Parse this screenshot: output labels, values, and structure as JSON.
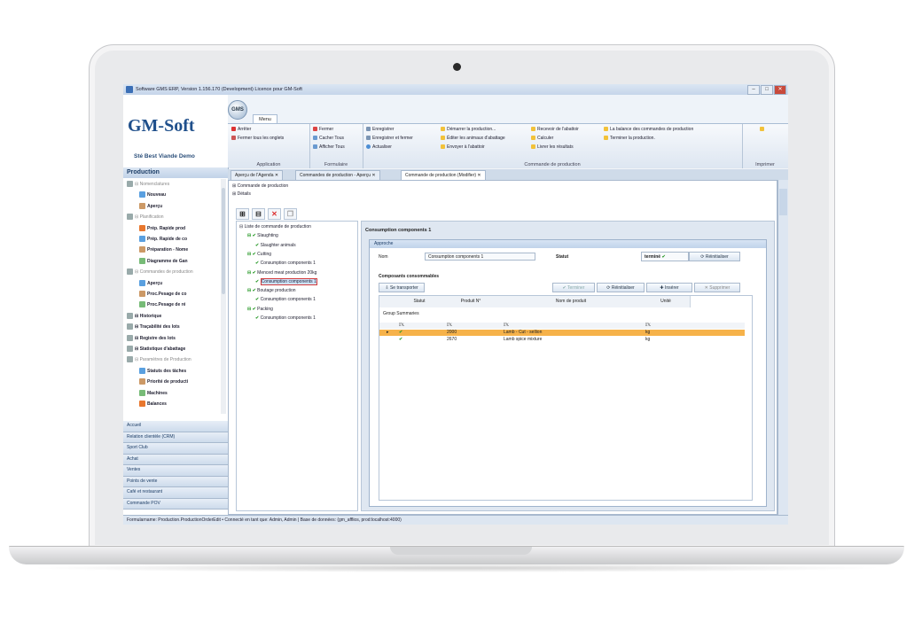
{
  "window": {
    "title": "Software GMS ERP, Version 1.156.170 (Development) Licence pour GM-Soft"
  },
  "logo": {
    "brand": "GM-Soft",
    "company": "Sté Best Viande Demo"
  },
  "ribbon": {
    "tab": "Menu",
    "groups": [
      {
        "label": "Application",
        "items": [
          "Arrêter",
          "Fermer tous les onglets"
        ]
      },
      {
        "label": "Formulaire",
        "items": [
          "Fermer",
          "Cacher Tous",
          "Afficher Tous"
        ]
      },
      {
        "label": "Commande de production",
        "items": [
          "Enregistrer",
          "Enregistrer et fermer",
          "Actualiser",
          "Démarrer la production...",
          "Éditer les animaux d'abattage",
          "Envoyer à l'abattoir",
          "Recevoir de l'abattoir",
          "Calculer",
          "Livrer les résultats",
          "La balance des commandes de production",
          "Terminer la production."
        ]
      },
      {
        "label": "Imprimer",
        "items": []
      }
    ]
  },
  "left_panel": {
    "title": "Production",
    "tree": [
      {
        "label": "Nomenclatures",
        "level": 0,
        "bold": false
      },
      {
        "label": "Nouveau",
        "level": 1,
        "bold": true
      },
      {
        "label": "Aperçu",
        "level": 1,
        "bold": true
      },
      {
        "label": "Planification",
        "level": 0,
        "bold": false
      },
      {
        "label": "Prép. Rapide prod",
        "level": 1,
        "bold": true
      },
      {
        "label": "Prép. Rapide de co",
        "level": 1,
        "bold": true
      },
      {
        "label": "Préparation - Nome",
        "level": 1,
        "bold": true
      },
      {
        "label": "Diagramme de Gan",
        "level": 1,
        "bold": true
      },
      {
        "label": "Commandes de production",
        "level": 0,
        "bold": false
      },
      {
        "label": "Aperçu",
        "level": 1,
        "bold": true
      },
      {
        "label": "Proc.Pesage de co",
        "level": 1,
        "bold": true
      },
      {
        "label": "Proc.Pesage de ré",
        "level": 1,
        "bold": true
      },
      {
        "label": "Historique",
        "level": 0,
        "bold": true
      },
      {
        "label": "Traçabilité des lots",
        "level": 0,
        "bold": true
      },
      {
        "label": "Registre des lots",
        "level": 0,
        "bold": true
      },
      {
        "label": "Statistique d'abattage",
        "level": 0,
        "bold": true
      },
      {
        "label": "Paramètres de Production",
        "level": 0,
        "bold": false
      },
      {
        "label": "Statuts des tâches",
        "level": 1,
        "bold": true
      },
      {
        "label": "Priorité de producti",
        "level": 1,
        "bold": true
      },
      {
        "label": "Machines",
        "level": 1,
        "bold": true
      },
      {
        "label": "Balances",
        "level": 1,
        "bold": true
      }
    ],
    "nav": [
      "Accueil",
      "Relation clientèle (CRM)",
      "Sport Club",
      "Achat",
      "Ventes",
      "Points de vente",
      "Café et restaurant",
      "Commande POV"
    ]
  },
  "doc_tabs": [
    "Aperçu de l'Agenda",
    "Commandes de production - Aperçu",
    "Commande de production (Modifier)"
  ],
  "content": {
    "sections": [
      "Commande de production",
      "Détails"
    ],
    "production_tree": [
      {
        "label": "Liste de commande de production",
        "level": 0,
        "check": false
      },
      {
        "label": "Slaughting",
        "level": 1,
        "check": true
      },
      {
        "label": "Slaughter animals",
        "level": 2,
        "check": true
      },
      {
        "label": "Cutting",
        "level": 1,
        "check": true
      },
      {
        "label": "Consumption components 1",
        "level": 2,
        "check": true
      },
      {
        "label": "Menced meat production 20kg",
        "level": 1,
        "check": true
      },
      {
        "label": "Consumption components 1",
        "level": 2,
        "check": true,
        "selected": true
      },
      {
        "label": "Boutage production",
        "level": 1,
        "check": true
      },
      {
        "label": "Consumption components 1",
        "level": 2,
        "check": true
      },
      {
        "label": "Packing",
        "level": 1,
        "check": true
      },
      {
        "label": "Consumption components 1",
        "level": 2,
        "check": true
      }
    ],
    "detail_title": "Consumption components 1",
    "approche_label": "Approche",
    "name_label": "Nom",
    "name_value": "Consumption components 1",
    "status_label": "Statut",
    "status_value": "terminé",
    "reinit_label": "Réinitialiser",
    "components_label": "Composants consommables",
    "toolbar": {
      "load": "Se transporter",
      "finish": "Terminer",
      "reinit": "Réinitialiser",
      "insert": "Insérer",
      "delete": "Supprimer"
    },
    "grid_headers": [
      "Statut",
      "Produit N°",
      "Nom de produit",
      "Unité"
    ],
    "group_summaries": "Group Summaries",
    "rows": [
      {
        "code": "2000",
        "name": "Lamb - Cut - sellion",
        "unit": "kg",
        "highlight": true
      },
      {
        "code": "2670",
        "name": "Lamb spice mixture",
        "unit": "kg",
        "highlight": false
      }
    ]
  },
  "statusbar": "Formularname: Production.ProductionOrderEdit  •  Connecté en tant que: Admin, Admin  |  Base de données: (gm_afflios, prod:localhost:4000)",
  "colors": {
    "accent": "#1f4f8b",
    "highlight_row": "#f6b24a",
    "check": "#2a9a2a"
  }
}
